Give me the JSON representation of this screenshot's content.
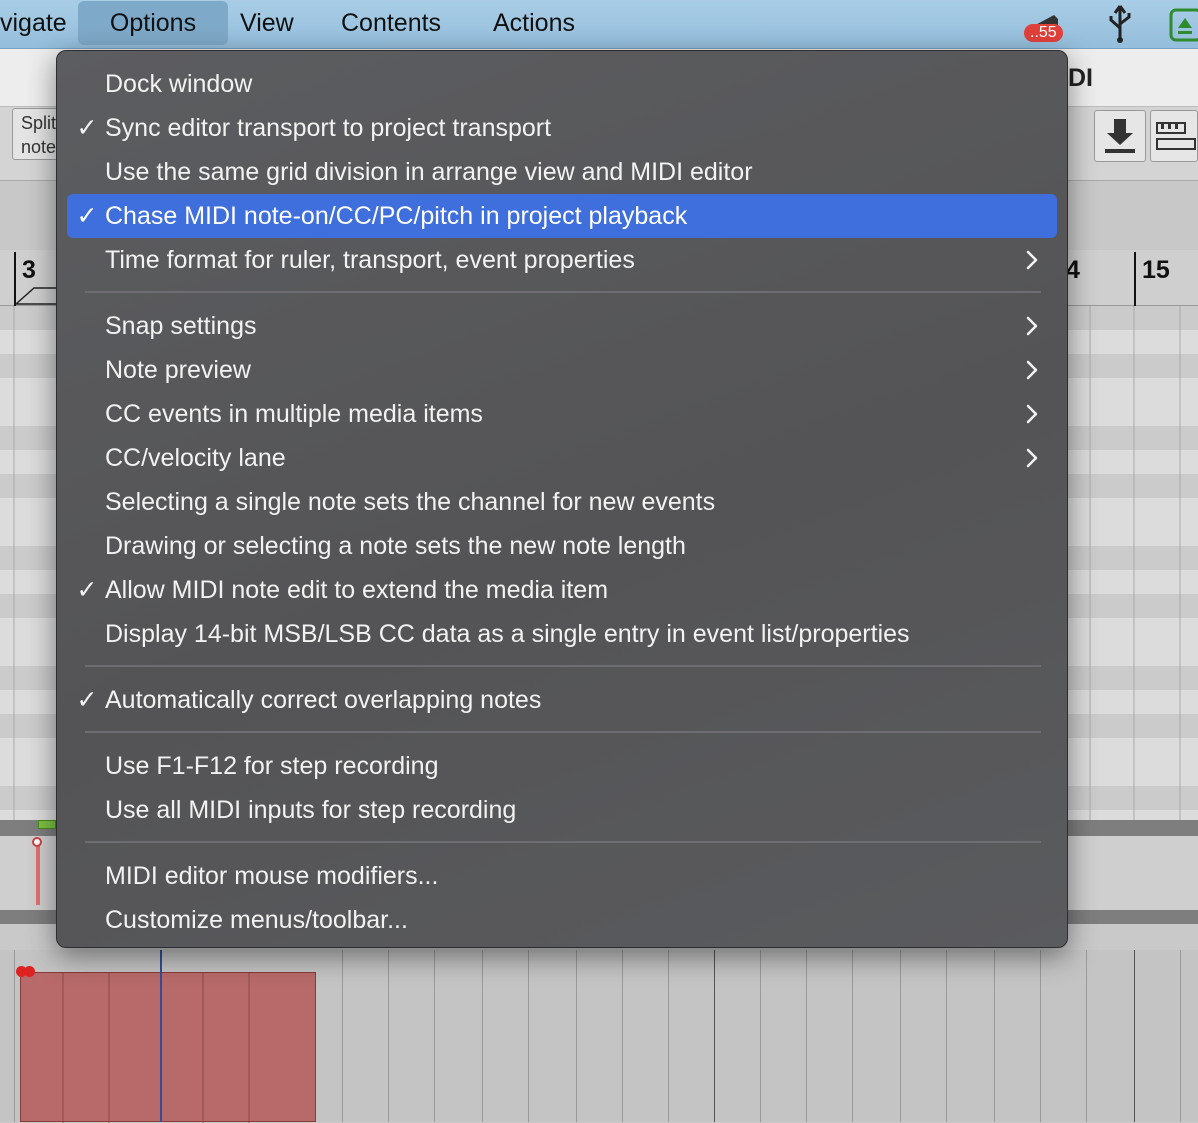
{
  "menubar": {
    "items": [
      "vigate",
      "Options",
      "View",
      "Contents",
      "Actions"
    ],
    "badge": "..55"
  },
  "background": {
    "title_fragment": "DI",
    "split_button": "Split notes",
    "ruler_left": "3",
    "ruler_mid": "4",
    "ruler_right": "15"
  },
  "menu": {
    "groups": [
      [
        {
          "label": "Dock window",
          "checked": false,
          "submenu": false
        },
        {
          "label": "Sync editor transport to project transport",
          "checked": true,
          "submenu": false
        },
        {
          "label": "Use the same grid division in arrange view and MIDI editor",
          "checked": false,
          "submenu": false
        },
        {
          "label": "Chase MIDI note-on/CC/PC/pitch in project playback",
          "checked": true,
          "submenu": false,
          "highlighted": true
        },
        {
          "label": "Time format for ruler, transport, event properties",
          "checked": false,
          "submenu": true
        }
      ],
      [
        {
          "label": "Snap settings",
          "checked": false,
          "submenu": true
        },
        {
          "label": "Note preview",
          "checked": false,
          "submenu": true
        },
        {
          "label": "CC events in multiple media items",
          "checked": false,
          "submenu": true
        },
        {
          "label": "CC/velocity lane",
          "checked": false,
          "submenu": true
        },
        {
          "label": "Selecting a single note sets the channel for new events",
          "checked": false,
          "submenu": false
        },
        {
          "label": "Drawing or selecting a note sets the new note length",
          "checked": false,
          "submenu": false
        },
        {
          "label": "Allow MIDI note edit to extend the media item",
          "checked": true,
          "submenu": false
        },
        {
          "label": "Display 14-bit MSB/LSB CC data as a single entry in event list/properties",
          "checked": false,
          "submenu": false
        }
      ],
      [
        {
          "label": "Automatically correct overlapping notes",
          "checked": true,
          "submenu": false
        }
      ],
      [
        {
          "label": "Use F1-F12 for step recording",
          "checked": false,
          "submenu": false
        },
        {
          "label": "Use all MIDI inputs for step recording",
          "checked": false,
          "submenu": false
        }
      ],
      [
        {
          "label": "MIDI editor mouse modifiers...",
          "checked": false,
          "submenu": false
        },
        {
          "label": "Customize menus/toolbar...",
          "checked": false,
          "submenu": false
        }
      ]
    ],
    "check_glyph": "✓",
    "submenu_glyph": "›"
  },
  "colors": {
    "menu_highlight": "#3f6fdc",
    "menubar": "#a9cde6",
    "note_fill": "#b86a6a"
  }
}
